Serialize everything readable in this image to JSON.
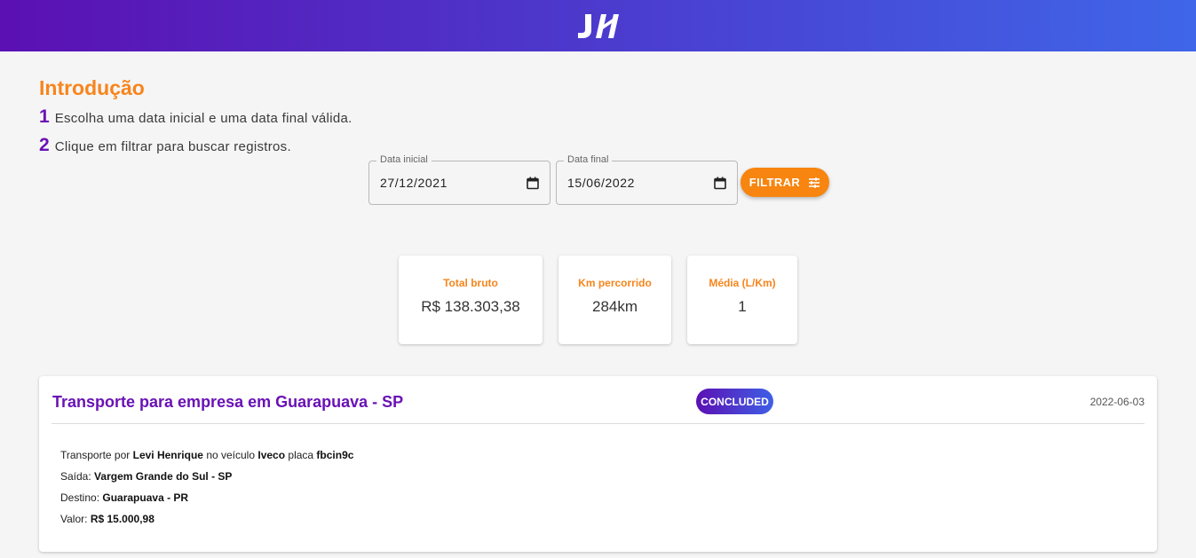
{
  "header": {
    "logo_icon": "jh-logo-icon"
  },
  "intro": {
    "title": "Introdução",
    "steps": [
      {
        "number": "1",
        "text": "Escolha uma data inicial e uma data final válida."
      },
      {
        "number": "2",
        "text": "Clique em filtrar para buscar registros."
      }
    ]
  },
  "filters": {
    "start": {
      "label": "Data inicial",
      "value": "27/12/2021"
    },
    "end": {
      "label": "Data final",
      "value": "15/06/2022"
    },
    "button_label": "FILTRAR",
    "button_icon": "tune-icon"
  },
  "stats": [
    {
      "label": "Total bruto",
      "value": "R$ 138.303,38"
    },
    {
      "label": "Km percorrido",
      "value": "284km"
    },
    {
      "label": "Média (L/Km)",
      "value": "1"
    }
  ],
  "trip": {
    "title": "Transporte para empresa em Guarapuava - SP",
    "status": "CONCLUDED",
    "date": "2022-06-03",
    "prefix": "Transporte por",
    "driver": "Levi Henrique",
    "vehicle_prefix": "no veículo",
    "vehicle": "Iveco",
    "plate_prefix": "placa",
    "plate": "fbcin9c",
    "departure_label": "Saída:",
    "departure": "Vargem Grande do Sul - SP",
    "destination_label": "Destino:",
    "destination": "Guarapuava - PR",
    "value_label": "Valor:",
    "value": "R$ 15.000,98"
  },
  "colors": {
    "accent_orange": "#f7851c",
    "accent_purple": "#6a12b5",
    "header_gradient_start": "#5b10b3",
    "header_gradient_end": "#3f66e8"
  }
}
